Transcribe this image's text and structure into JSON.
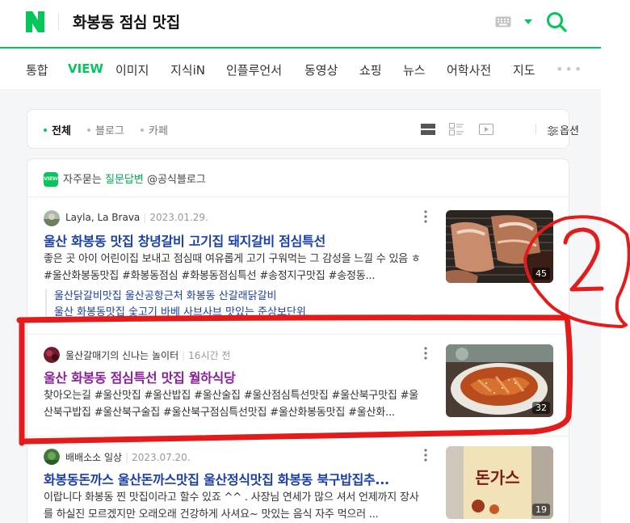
{
  "header": {
    "logo_letter": "N",
    "query": "화봉동 점심 맛집"
  },
  "tabs": [
    "통합",
    "VIEW",
    "이미지",
    "지식iN",
    "인플루언서",
    "동영상",
    "쇼핑",
    "뉴스",
    "어학사전",
    "지도"
  ],
  "more_label": "•••",
  "filters": {
    "all": "전체",
    "blog": "블로그",
    "cafe": "카페",
    "options": "옵션"
  },
  "kin": {
    "badge": "VIEW",
    "prefix": "자주묻는",
    "highlight": "질문답변",
    "suffix": "@공식블로그"
  },
  "posts": [
    {
      "author": "Layla, La Brava",
      "date": "2023.01.29.",
      "title": "울산 화봉동 맛집 창녕갈비 고기집 돼지갈비 점심특선",
      "desc": "좋은 곳 아이 어린이집 보내고 점심때 여유롭게 고기 구워먹는 그 감성을 느낄 수 있음 ㅎ #울산화봉동맛집 #화봉동점심 #화봉동점심특선 #송정지구맛집 #송정동...",
      "count": "45",
      "related": [
        "울산닭갈비맛집 울산공항근처 화봉동 산갈래닭갈비",
        "울산 화봉동맛집 숯고기 바베 사브사브 맛있는 준상보단위"
      ]
    },
    {
      "author": "울산갈매기의 신나는 놀이터",
      "date": "16시간 전",
      "title": "울산 화봉동 점심특선 맛집 월하식당",
      "desc": "찾아오는길 #울산맛집 #울산밥집 #울산술집 #울산점심특선맛집 #울산북구맛집 #울산북구밥집 #울산북구술집 #울산북구점심특선맛집 #울산화봉동맛집 #울산화...",
      "count": "32"
    },
    {
      "author": "배배소소 일상",
      "date": "2023.07.20.",
      "title": "화봉동돈까스 울산돈까스맛집 울산정식맛집 화봉동 북구밥집추...",
      "desc": "이랍니다 화봉동 찐 맛집이라고 할수 있죠 ^^ . 사장님 연세가 많으 셔서 언제까지 장사를 하실진 모르겠지만 오래오래 건강하게 사셔요~ 맛있는 음식 자주 먹으러 ...",
      "count": "19",
      "sign_text": "돈가스"
    }
  ],
  "annotation": {
    "number": "2",
    "color": "#e31b1b"
  },
  "colors": {
    "brand": "#03c75a",
    "link": "#1a3fa8",
    "visited": "#8a1f9c"
  }
}
